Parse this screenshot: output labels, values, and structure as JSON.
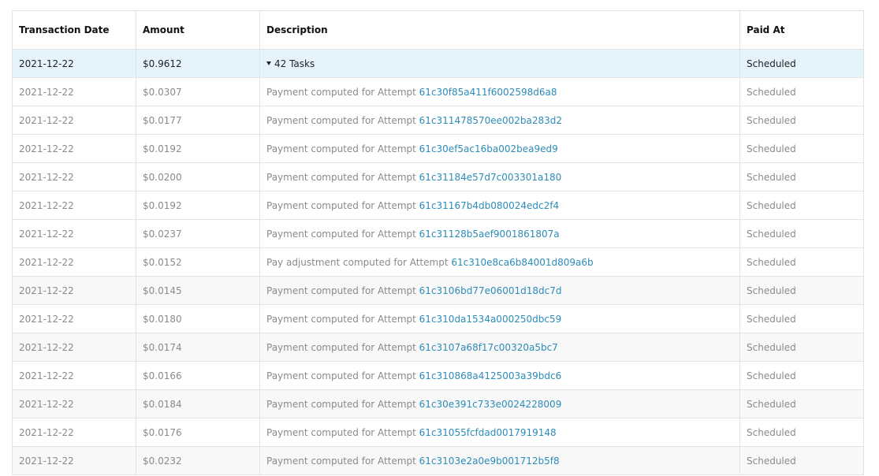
{
  "headers": {
    "date": "Transaction Date",
    "amount": "Amount",
    "description": "Description",
    "paid_at": "Paid At"
  },
  "group": {
    "date": "2021-12-22",
    "amount": "$0.9612",
    "label": "42 Tasks",
    "paid_at": "Scheduled"
  },
  "rows": [
    {
      "date": "2021-12-22",
      "amount": "$0.0307",
      "prefix": "Payment computed for Attempt",
      "attempt": "61c30f85a411f6002598d6a8",
      "paid_at": "Scheduled"
    },
    {
      "date": "2021-12-22",
      "amount": "$0.0177",
      "prefix": "Payment computed for Attempt",
      "attempt": "61c311478570ee002ba283d2",
      "paid_at": "Scheduled"
    },
    {
      "date": "2021-12-22",
      "amount": "$0.0192",
      "prefix": "Payment computed for Attempt",
      "attempt": "61c30ef5ac16ba002bea9ed9",
      "paid_at": "Scheduled"
    },
    {
      "date": "2021-12-22",
      "amount": "$0.0200",
      "prefix": "Payment computed for Attempt",
      "attempt": "61c31184e57d7c003301a180",
      "paid_at": "Scheduled"
    },
    {
      "date": "2021-12-22",
      "amount": "$0.0192",
      "prefix": "Payment computed for Attempt",
      "attempt": "61c31167b4db080024edc2f4",
      "paid_at": "Scheduled"
    },
    {
      "date": "2021-12-22",
      "amount": "$0.0237",
      "prefix": "Payment computed for Attempt",
      "attempt": "61c31128b5aef9001861807a",
      "paid_at": "Scheduled"
    },
    {
      "date": "2021-12-22",
      "amount": "$0.0152",
      "prefix": "Pay adjustment computed for Attempt",
      "attempt": "61c310e8ca6b84001d809a6b",
      "paid_at": "Scheduled"
    },
    {
      "date": "2021-12-22",
      "amount": "$0.0145",
      "prefix": "Payment computed for Attempt",
      "attempt": "61c3106bd77e06001d18dc7d",
      "paid_at": "Scheduled"
    },
    {
      "date": "2021-12-22",
      "amount": "$0.0180",
      "prefix": "Payment computed for Attempt",
      "attempt": "61c310da1534a000250dbc59",
      "paid_at": "Scheduled"
    },
    {
      "date": "2021-12-22",
      "amount": "$0.0174",
      "prefix": "Payment computed for Attempt",
      "attempt": "61c3107a68f17c00320a5bc7",
      "paid_at": "Scheduled"
    },
    {
      "date": "2021-12-22",
      "amount": "$0.0166",
      "prefix": "Payment computed for Attempt",
      "attempt": "61c310868a4125003a39bdc6",
      "paid_at": "Scheduled"
    },
    {
      "date": "2021-12-22",
      "amount": "$0.0184",
      "prefix": "Payment computed for Attempt",
      "attempt": "61c30e391c733e0024228009",
      "paid_at": "Scheduled"
    },
    {
      "date": "2021-12-22",
      "amount": "$0.0176",
      "prefix": "Payment computed for Attempt",
      "attempt": "61c31055fcfdad0017919148",
      "paid_at": "Scheduled"
    },
    {
      "date": "2021-12-22",
      "amount": "$0.0232",
      "prefix": "Payment computed for Attempt",
      "attempt": "61c3103e2a0e9b001712b5f8",
      "paid_at": "Scheduled"
    }
  ]
}
